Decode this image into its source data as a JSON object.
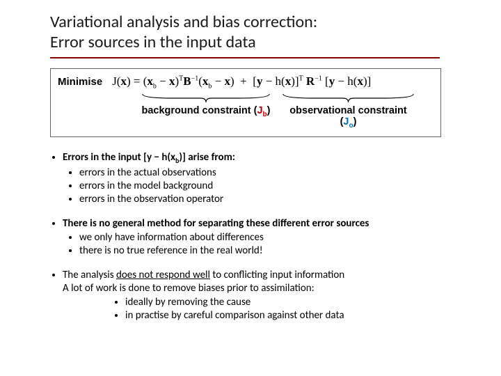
{
  "title_line1": "Variational analysis and bias correction:",
  "title_line2": "Error sources in the input data",
  "eqbox": {
    "minimise": "Minimise",
    "brace1_label_a": "background constraint (",
    "brace1_label_j": "J",
    "brace1_label_sub": "b",
    "brace1_label_close": ")",
    "brace2_label_a": "observational constraint (",
    "brace2_label_j": "J",
    "brace2_label_sub": "o",
    "brace2_label_close": ")"
  },
  "b1": {
    "lead_a": "Errors in the input [y − h(x",
    "lead_sub": "b",
    "lead_b": ")] arise from:",
    "items": [
      "errors in the actual observations",
      "errors in the model background",
      "errors in the observation operator"
    ]
  },
  "b2": {
    "lead": "There is no general method for separating these different error sources",
    "items": [
      "we only have information about differences",
      "there is no true reference in the real world!"
    ]
  },
  "b3": {
    "line1_a": "The analysis ",
    "line1_u": "does not respond well",
    "line1_b": " to conflicting input information",
    "line2": "A lot of work is done to remove biases prior to assimilation:",
    "items": [
      "ideally by removing the cause",
      "in practise by careful comparison against other data"
    ]
  }
}
